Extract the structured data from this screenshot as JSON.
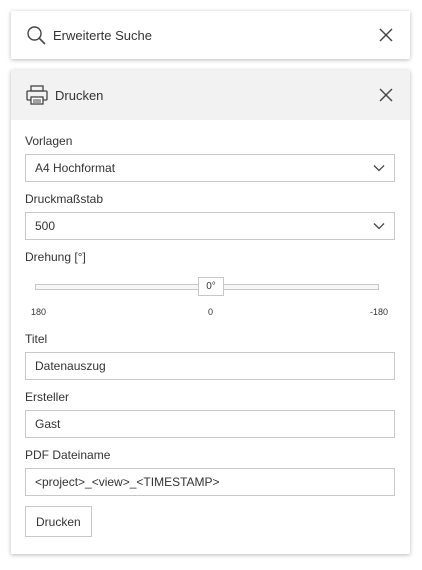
{
  "search_panel": {
    "title": "Erweiterte Suche",
    "icon": "search-icon",
    "close_icon": "close-icon"
  },
  "print_panel": {
    "title": "Drucken",
    "icon": "printer-icon",
    "close_icon": "close-icon",
    "templates": {
      "label": "Vorlagen",
      "value": "A4 Hochformat"
    },
    "scale": {
      "label": "Druckmaßstab",
      "value": "500"
    },
    "rotation": {
      "label": "Drehung [°]",
      "handle_value": "0°",
      "value_deg": 0,
      "min_label": "180",
      "mid_label": "0",
      "max_label": "-180"
    },
    "title_field": {
      "label": "Titel",
      "value": "Datenauszug"
    },
    "creator_field": {
      "label": "Ersteller",
      "value": "Gast"
    },
    "pdf_filename": {
      "label": "PDF Dateiname",
      "value": "<project>_<view>_<TIMESTAMP>"
    },
    "print_button": "Drucken"
  }
}
